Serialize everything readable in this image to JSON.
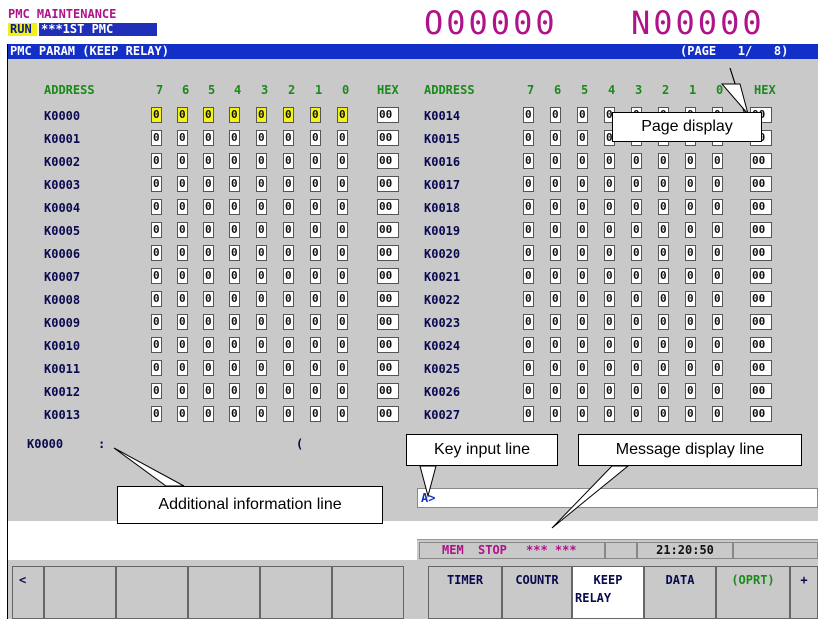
{
  "header": {
    "mode_title": "PMC MAINTENANCE",
    "run_label": "RUN",
    "run_status": "***1ST PMC",
    "o_number": "O00000",
    "n_number": "N00000"
  },
  "screen": {
    "title": "PMC PARAM (KEEP RELAY)",
    "page_indicator": "(PAGE   1/   8)"
  },
  "table": {
    "col_headers": [
      "ADDRESS",
      "7",
      "6",
      "5",
      "4",
      "3",
      "2",
      "1",
      "0",
      "HEX"
    ],
    "left_rows": [
      {
        "address": "K0000",
        "bits": [
          "0",
          "0",
          "0",
          "0",
          "0",
          "0",
          "0",
          "0"
        ],
        "hex": "00",
        "selected": true
      },
      {
        "address": "K0001",
        "bits": [
          "0",
          "0",
          "0",
          "0",
          "0",
          "0",
          "0",
          "0"
        ],
        "hex": "00"
      },
      {
        "address": "K0002",
        "bits": [
          "0",
          "0",
          "0",
          "0",
          "0",
          "0",
          "0",
          "0"
        ],
        "hex": "00"
      },
      {
        "address": "K0003",
        "bits": [
          "0",
          "0",
          "0",
          "0",
          "0",
          "0",
          "0",
          "0"
        ],
        "hex": "00"
      },
      {
        "address": "K0004",
        "bits": [
          "0",
          "0",
          "0",
          "0",
          "0",
          "0",
          "0",
          "0"
        ],
        "hex": "00"
      },
      {
        "address": "K0005",
        "bits": [
          "0",
          "0",
          "0",
          "0",
          "0",
          "0",
          "0",
          "0"
        ],
        "hex": "00"
      },
      {
        "address": "K0006",
        "bits": [
          "0",
          "0",
          "0",
          "0",
          "0",
          "0",
          "0",
          "0"
        ],
        "hex": "00"
      },
      {
        "address": "K0007",
        "bits": [
          "0",
          "0",
          "0",
          "0",
          "0",
          "0",
          "0",
          "0"
        ],
        "hex": "00"
      },
      {
        "address": "K0008",
        "bits": [
          "0",
          "0",
          "0",
          "0",
          "0",
          "0",
          "0",
          "0"
        ],
        "hex": "00"
      },
      {
        "address": "K0009",
        "bits": [
          "0",
          "0",
          "0",
          "0",
          "0",
          "0",
          "0",
          "0"
        ],
        "hex": "00"
      },
      {
        "address": "K0010",
        "bits": [
          "0",
          "0",
          "0",
          "0",
          "0",
          "0",
          "0",
          "0"
        ],
        "hex": "00"
      },
      {
        "address": "K0011",
        "bits": [
          "0",
          "0",
          "0",
          "0",
          "0",
          "0",
          "0",
          "0"
        ],
        "hex": "00"
      },
      {
        "address": "K0012",
        "bits": [
          "0",
          "0",
          "0",
          "0",
          "0",
          "0",
          "0",
          "0"
        ],
        "hex": "00"
      },
      {
        "address": "K0013",
        "bits": [
          "0",
          "0",
          "0",
          "0",
          "0",
          "0",
          "0",
          "0"
        ],
        "hex": "00"
      }
    ],
    "right_rows": [
      {
        "address": "K0014",
        "bits": [
          "0",
          "0",
          "0",
          "0",
          "0",
          "0",
          "0",
          "0"
        ],
        "hex": "00"
      },
      {
        "address": "K0015",
        "bits": [
          "0",
          "0",
          "0",
          "0",
          "0",
          "0",
          "0",
          "0"
        ],
        "hex": "00"
      },
      {
        "address": "K0016",
        "bits": [
          "0",
          "0",
          "0",
          "0",
          "0",
          "0",
          "0",
          "0"
        ],
        "hex": "00"
      },
      {
        "address": "K0017",
        "bits": [
          "0",
          "0",
          "0",
          "0",
          "0",
          "0",
          "0",
          "0"
        ],
        "hex": "00"
      },
      {
        "address": "K0018",
        "bits": [
          "0",
          "0",
          "0",
          "0",
          "0",
          "0",
          "0",
          "0"
        ],
        "hex": "00"
      },
      {
        "address": "K0019",
        "bits": [
          "0",
          "0",
          "0",
          "0",
          "0",
          "0",
          "0",
          "0"
        ],
        "hex": "00"
      },
      {
        "address": "K0020",
        "bits": [
          "0",
          "0",
          "0",
          "0",
          "0",
          "0",
          "0",
          "0"
        ],
        "hex": "00"
      },
      {
        "address": "K0021",
        "bits": [
          "0",
          "0",
          "0",
          "0",
          "0",
          "0",
          "0",
          "0"
        ],
        "hex": "00"
      },
      {
        "address": "K0022",
        "bits": [
          "0",
          "0",
          "0",
          "0",
          "0",
          "0",
          "0",
          "0"
        ],
        "hex": "00"
      },
      {
        "address": "K0023",
        "bits": [
          "0",
          "0",
          "0",
          "0",
          "0",
          "0",
          "0",
          "0"
        ],
        "hex": "00"
      },
      {
        "address": "K0024",
        "bits": [
          "0",
          "0",
          "0",
          "0",
          "0",
          "0",
          "0",
          "0"
        ],
        "hex": "00"
      },
      {
        "address": "K0025",
        "bits": [
          "0",
          "0",
          "0",
          "0",
          "0",
          "0",
          "0",
          "0"
        ],
        "hex": "00"
      },
      {
        "address": "K0026",
        "bits": [
          "0",
          "0",
          "0",
          "0",
          "0",
          "0",
          "0",
          "0"
        ],
        "hex": "00"
      },
      {
        "address": "K0027",
        "bits": [
          "0",
          "0",
          "0",
          "0",
          "0",
          "0",
          "0",
          "0"
        ],
        "hex": "00"
      }
    ]
  },
  "additional_info": {
    "address": "K0000",
    "colon": ":",
    "paren": "("
  },
  "key_input": {
    "prompt": "A>"
  },
  "status_bar": {
    "mode": "MEM",
    "state": "STOP",
    "alarm": "*** ***",
    "clock": "21:20:50"
  },
  "softkeys": {
    "left_arrow": "<",
    "timer": "TIMER",
    "counter": "COUNTR",
    "keep_relay_l1": "KEEP",
    "keep_relay_l2": "RELAY",
    "data": "DATA",
    "oprt": "(OPRT)",
    "plus": "+"
  },
  "annotations": {
    "page_display": "Page display",
    "key_input_line": "Key input line",
    "message_display_line": "Message display line",
    "additional_information_line": "Additional information line"
  },
  "colors": {
    "magenta": "#b0128a",
    "title_blue": "#1230c8",
    "panel_gray": "#c9c9c9",
    "header_green": "#1a8a1a",
    "select_yellow": "#f3f31a"
  }
}
